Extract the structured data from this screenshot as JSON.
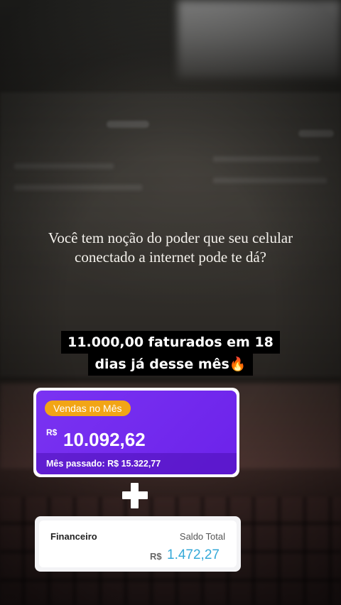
{
  "story": {
    "question": "Você tem noção do poder que seu celular conectado a internet pode te dá?",
    "headline_line1": "11.000,00 faturados em 18",
    "headline_line2": "dias já desse mês🔥"
  },
  "sales_card": {
    "badge": "Vendas no Mês",
    "currency": "R$",
    "value": "10.092,62",
    "previous_month": "Mês passado: R$ 15.322,77",
    "accent_color": "#7a33f2",
    "badge_color": "#f2a516"
  },
  "plus_icon": "plus-icon",
  "finance_card": {
    "title": "Financeiro",
    "label": "Saldo Total",
    "currency": "R$",
    "value": "1.472,27",
    "value_color": "#35a9d8"
  }
}
